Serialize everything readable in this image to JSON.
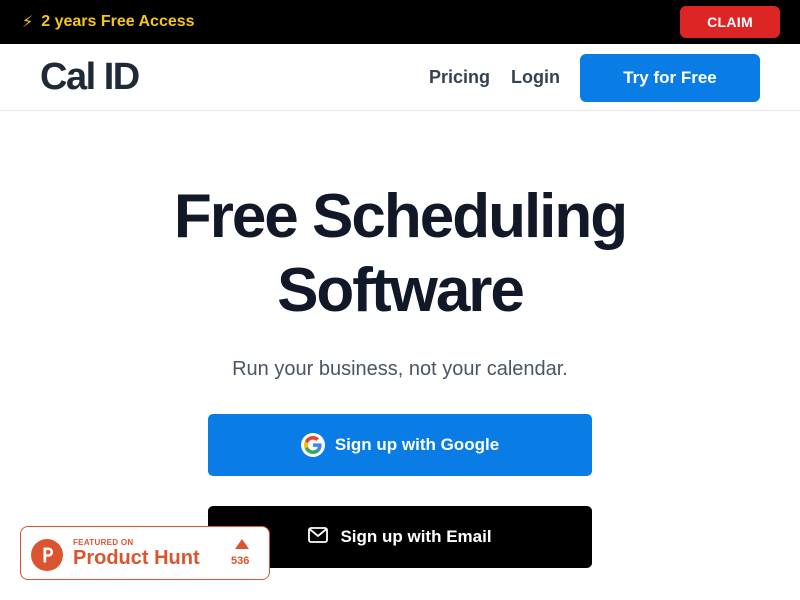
{
  "promo": {
    "text": "2 years Free Access",
    "icon": "lightning-icon",
    "claim_label": "CLAIM"
  },
  "header": {
    "logo": "Cal ID",
    "nav": {
      "pricing": "Pricing",
      "login": "Login"
    },
    "cta_label": "Try for Free"
  },
  "hero": {
    "title_line1": "Free Scheduling",
    "title_line2": "Software",
    "subtitle": "Run your business, not your calendar.",
    "google_label": "Sign up with Google",
    "email_label": "Sign up with Email"
  },
  "product_hunt": {
    "featured": "FEATURED ON",
    "name": "Product Hunt",
    "count": "536"
  },
  "colors": {
    "accent_blue": "#0a7ce6",
    "promo_yellow": "#f5c518",
    "claim_red": "#dc2626",
    "product_hunt": "#da552f"
  }
}
